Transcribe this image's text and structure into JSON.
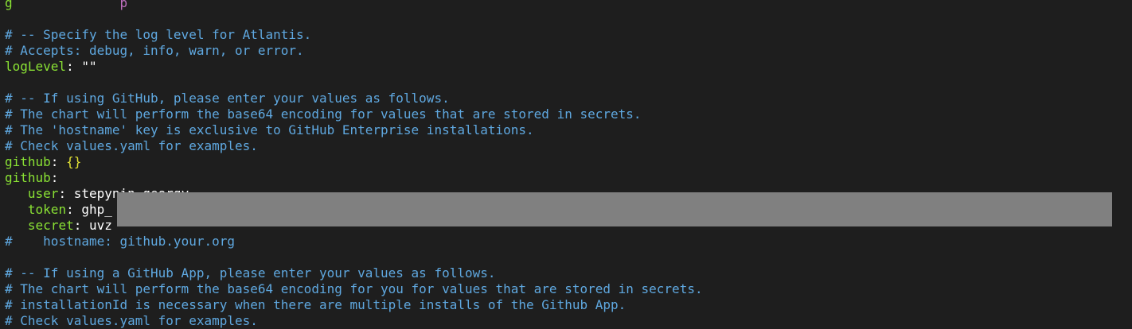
{
  "lines": {
    "l0_key": "g",
    "l0_rest": "p",
    "c1": "# -- Specify the log level for Atlantis.",
    "c2": "# Accepts: debug, info, warn, or error.",
    "logLevel_key": "logLevel",
    "logLevel_val": "\"\"",
    "c3": "# -- If using GitHub, please enter your values as follows.",
    "c4": "# The chart will perform the base64 encoding for values that are stored in secrets.",
    "c5": "# The 'hostname' key is exclusive to GitHub Enterprise installations.",
    "c6": "# Check values.yaml for examples.",
    "github1_key": "github",
    "github1_val": "{}",
    "github2_key": "github",
    "user_key": "user",
    "user_val": "stepynin-georgy",
    "token_key": "token",
    "token_val": "ghp_",
    "secret_key": "secret",
    "secret_val": "uvz",
    "hostname_hash": "#",
    "hostname_key": "hostname",
    "hostname_val": "github.your.org",
    "c7": "# -- If using a GitHub App, please enter your values as follows.",
    "c8": "# The chart will perform the base64 encoding for you for values that are stored in secrets.",
    "c9": "# installationId is necessary when there are multiple installs of the Github App.",
    "c10": "# Check values.yaml for examples."
  },
  "colors": {
    "background": "#1e1e1e",
    "comment": "#5fa8e0",
    "key": "#8ae234",
    "value": "#ffffff",
    "brace": "#e0e034",
    "redaction": "#808080"
  }
}
